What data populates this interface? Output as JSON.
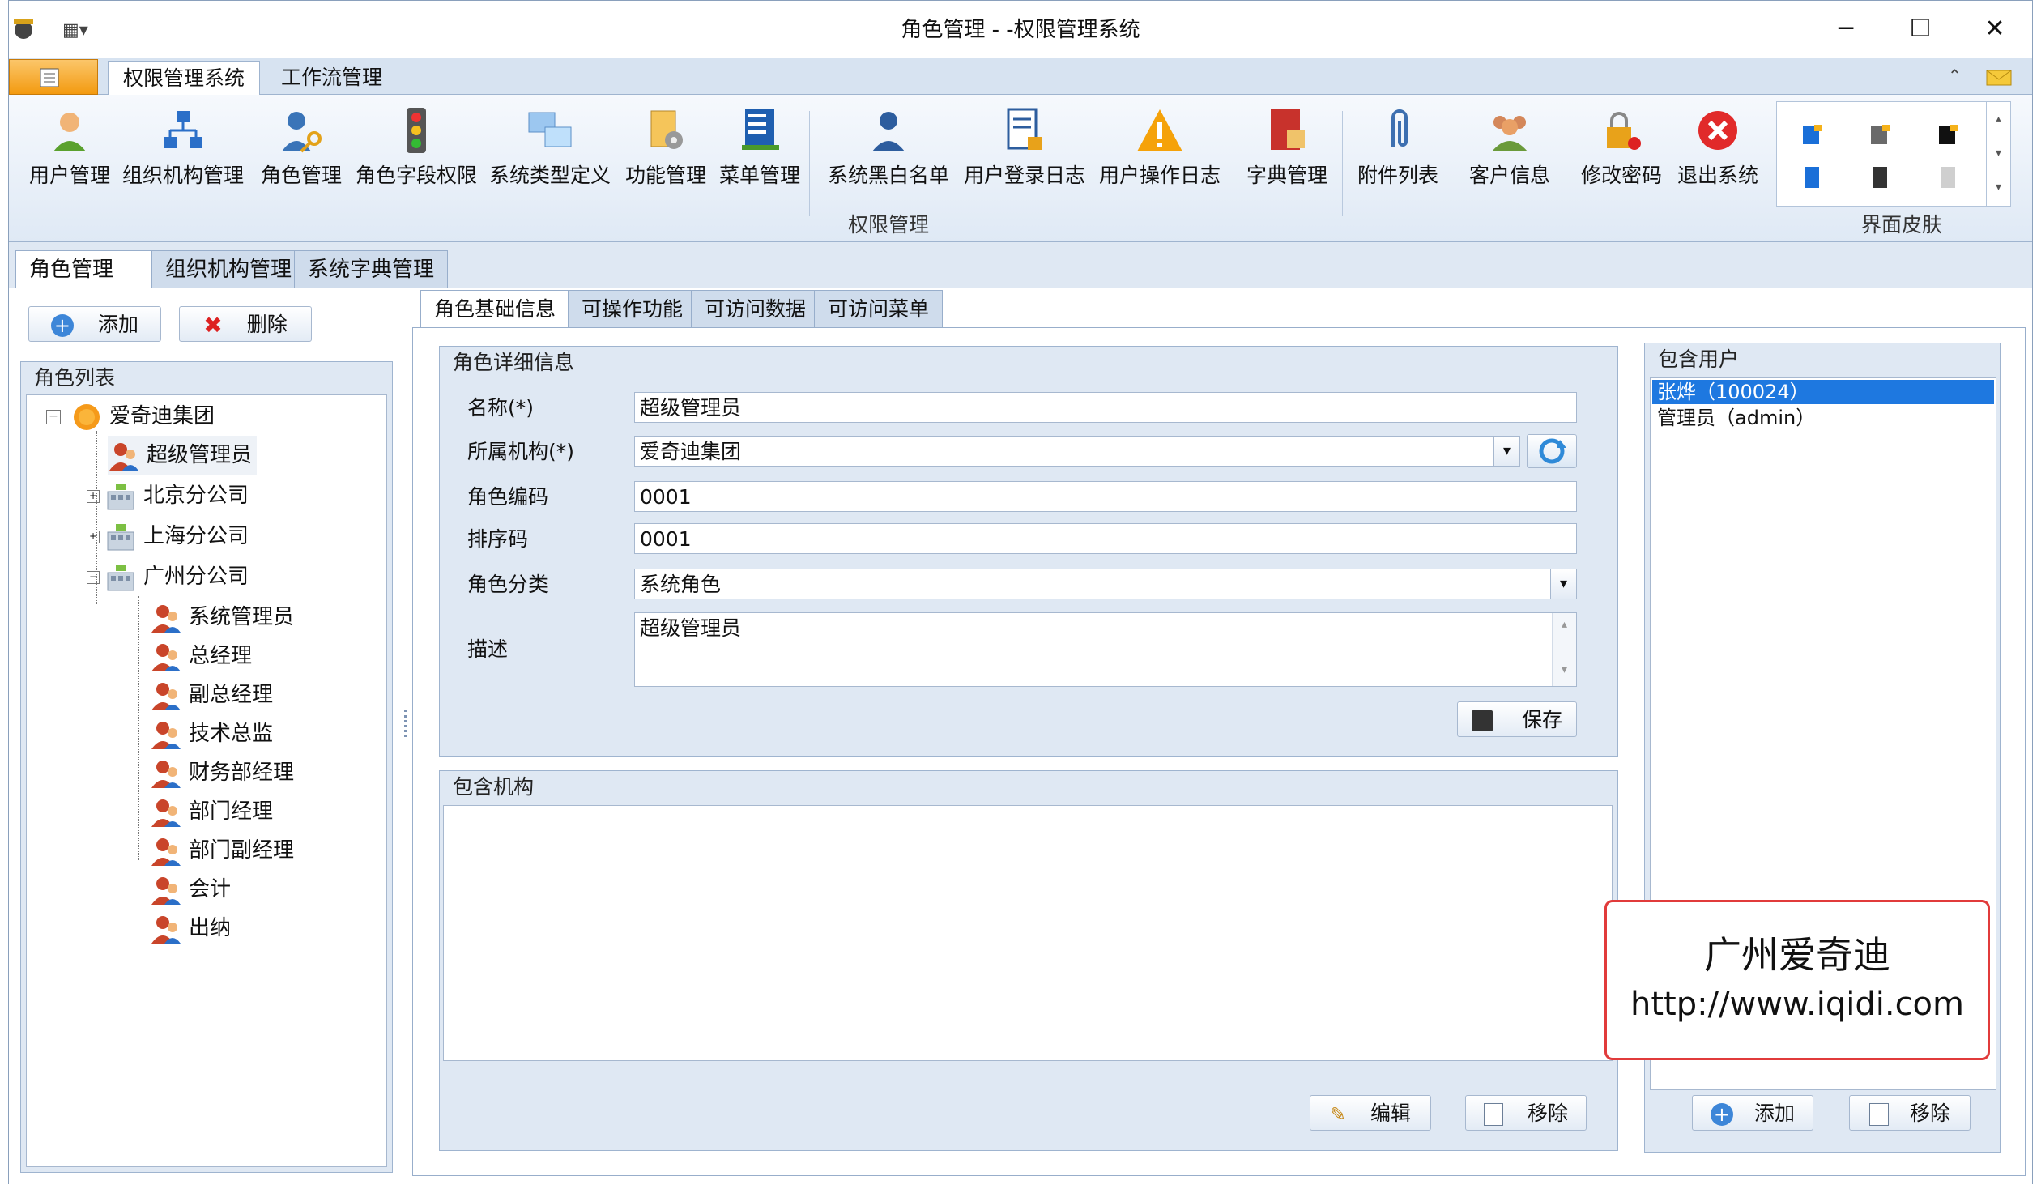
{
  "window": {
    "title": "角色管理 - -权限管理系统"
  },
  "ribbon": {
    "tabs": [
      {
        "label": "权限管理系统",
        "active": true
      },
      {
        "label": "工作流管理",
        "active": false
      }
    ],
    "buttons": [
      {
        "label": "用户管理",
        "icon": "user-icon"
      },
      {
        "label": "组织机构管理",
        "icon": "org-chart-icon"
      },
      {
        "label": "角色管理",
        "icon": "role-key-icon"
      },
      {
        "label": "角色字段权限",
        "icon": "traffic-light-icon"
      },
      {
        "label": "系统类型定义",
        "icon": "computers-icon"
      },
      {
        "label": "功能管理",
        "icon": "function-gear-icon"
      },
      {
        "label": "菜单管理",
        "icon": "menu-book-icon"
      },
      {
        "label": "系统黑白名单",
        "icon": "person-icon"
      },
      {
        "label": "用户登录日志",
        "icon": "log-lock-icon"
      },
      {
        "label": "用户操作日志",
        "icon": "warning-icon"
      },
      {
        "label": "字典管理",
        "icon": "dictionary-icon"
      },
      {
        "label": "附件列表",
        "icon": "paperclip-icon"
      },
      {
        "label": "客户信息",
        "icon": "group-icon"
      },
      {
        "label": "修改密码",
        "icon": "password-lock-icon"
      },
      {
        "label": "退出系统",
        "icon": "exit-icon"
      }
    ],
    "group_label": "权限管理",
    "skin_group_label": "界面皮肤"
  },
  "doc_tabs": [
    {
      "label": "角色管理",
      "active": true
    },
    {
      "label": "组织机构管理",
      "active": false
    },
    {
      "label": "系统字典管理",
      "active": false
    }
  ],
  "left": {
    "add_label": "添加",
    "delete_label": "删除",
    "list_title": "角色列表",
    "tree": [
      {
        "label": "爱奇迪集团",
        "level": 0,
        "kind": "root"
      },
      {
        "label": "超级管理员",
        "level": 1,
        "kind": "role",
        "selected": true
      },
      {
        "label": "北京分公司",
        "level": 1,
        "kind": "org"
      },
      {
        "label": "上海分公司",
        "level": 1,
        "kind": "org"
      },
      {
        "label": "广州分公司",
        "level": 1,
        "kind": "org"
      },
      {
        "label": "系统管理员",
        "level": 2,
        "kind": "role"
      },
      {
        "label": "总经理",
        "level": 2,
        "kind": "role"
      },
      {
        "label": "副总经理",
        "level": 2,
        "kind": "role"
      },
      {
        "label": "技术总监",
        "level": 2,
        "kind": "role"
      },
      {
        "label": "财务部经理",
        "level": 2,
        "kind": "role"
      },
      {
        "label": "部门经理",
        "level": 2,
        "kind": "role"
      },
      {
        "label": "部门副经理",
        "level": 2,
        "kind": "role"
      },
      {
        "label": "会计",
        "level": 2,
        "kind": "role"
      },
      {
        "label": "出纳",
        "level": 2,
        "kind": "role"
      }
    ]
  },
  "inner_tabs": [
    {
      "label": "角色基础信息",
      "active": true
    },
    {
      "label": "可操作功能",
      "active": false
    },
    {
      "label": "可访问数据",
      "active": false
    },
    {
      "label": "可访问菜单",
      "active": false
    }
  ],
  "detail": {
    "title": "角色详细信息",
    "name_label": "名称(*)",
    "name_value": "超级管理员",
    "org_label": "所属机构(*)",
    "org_value": "爱奇迪集团",
    "code_label": "角色编码",
    "code_value": "0001",
    "sort_label": "排序码",
    "sort_value": "0001",
    "category_label": "角色分类",
    "category_value": "系统角色",
    "desc_label": "描述",
    "desc_value": "超级管理员",
    "save_label": "保存"
  },
  "orgs": {
    "title": "包含机构",
    "edit_label": "编辑",
    "remove_label": "移除"
  },
  "users": {
    "title": "包含用户",
    "items": [
      {
        "label": "张烨（100024）",
        "selected": true
      },
      {
        "label": "管理员（admin）",
        "selected": false
      }
    ],
    "add_label": "添加",
    "remove_label": "移除"
  },
  "watermark": {
    "line1": "广州爱奇迪",
    "line2": "http://www.iqidi.com"
  },
  "colors": {
    "accent": "#2f7bd8",
    "frame": "#dfe8f3",
    "selection": "#1e78e0",
    "watermark_border": "#e13b3b"
  }
}
